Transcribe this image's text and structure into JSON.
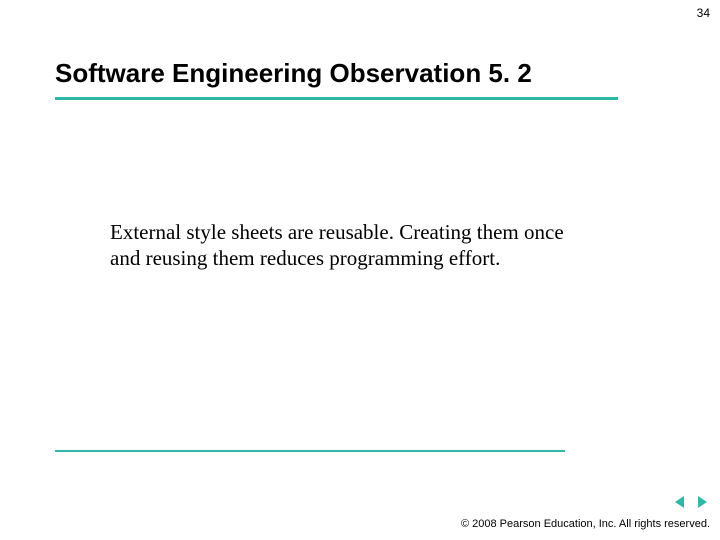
{
  "page_number": "34",
  "title": "Software Engineering Observation 5. 2",
  "body": "External style sheets are reusable. Creating them once and reusing them reduces programming effort.",
  "copyright_symbol": "©",
  "copyright_text": "2008 Pearson Education, Inc.  All rights reserved.",
  "accent_color": "#2fb8a8",
  "nav": {
    "prev": "Previous slide",
    "next": "Next slide"
  }
}
